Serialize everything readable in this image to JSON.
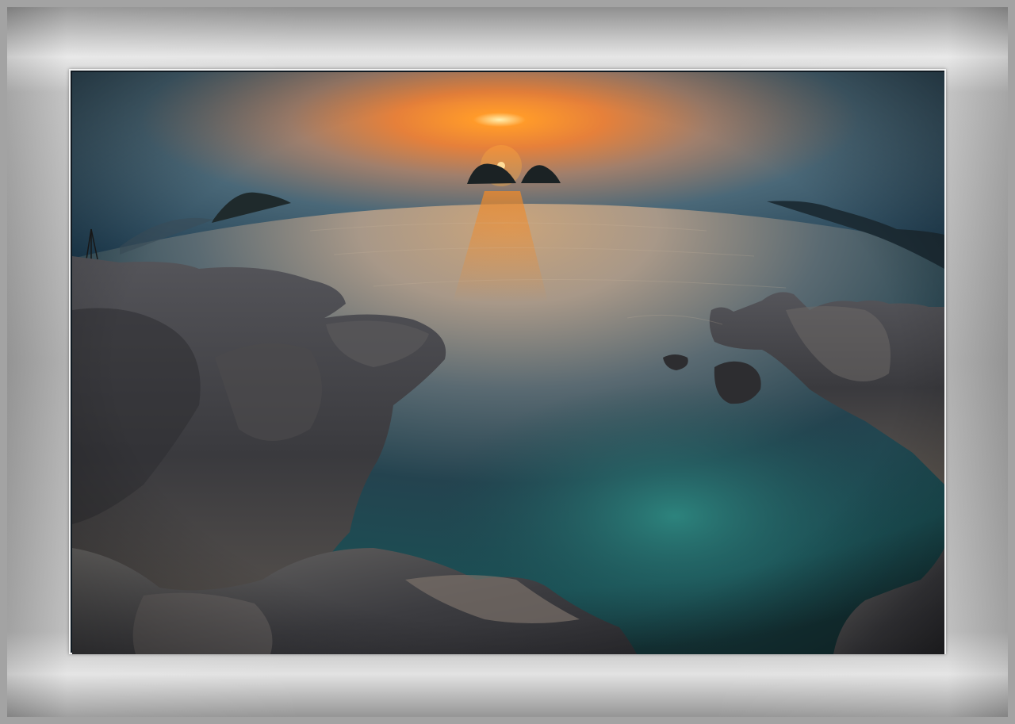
{
  "frame": {
    "mat_color": "#b0b0b0",
    "border_color": "#f2f2f2"
  },
  "photo": {
    "subject": "sunset-over-sea-with-rocky-shore",
    "colors": {
      "sky_top": "#1f4156",
      "sky_glow": "#f07a1e",
      "sun": "#fff2b0",
      "sea_far": "#b8a389",
      "sea_mid": "#2d4a58",
      "sea_near": "#1f6a68",
      "rock": "#3e3e42"
    }
  }
}
